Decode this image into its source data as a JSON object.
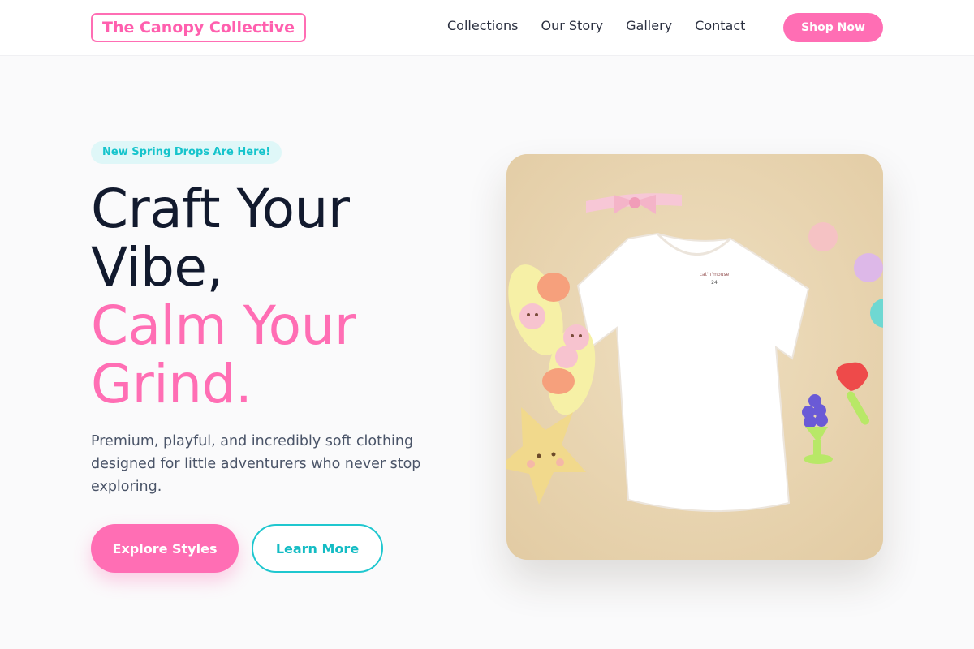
{
  "brand": {
    "name": "The Canopy Collective"
  },
  "nav": {
    "items": [
      {
        "label": "Collections"
      },
      {
        "label": "Our Story"
      },
      {
        "label": "Gallery"
      },
      {
        "label": "Contact"
      }
    ],
    "cta_label": "Shop Now"
  },
  "hero": {
    "badge": "New Spring Drops Are Here!",
    "headline": {
      "line1": "Craft Your",
      "line2": "Vibe,",
      "line3": "Calm Your",
      "line4": "Grind."
    },
    "subtitle": "Premium, playful, and incredibly soft clothing designed for little adventurers who never stop exploring.",
    "primary_button": "Explore Styles",
    "secondary_button": "Learn More",
    "image": {
      "subject": "flat-lay-baby-tshirt-photo",
      "tag_text_1": "cat'n'mouse",
      "tag_text_2": "24"
    }
  },
  "colors": {
    "accent_pink": "#ff6eb4",
    "accent_teal": "#1fc7cf",
    "heading_dark": "#121a2e",
    "photo_background": "#e9d5b1"
  }
}
